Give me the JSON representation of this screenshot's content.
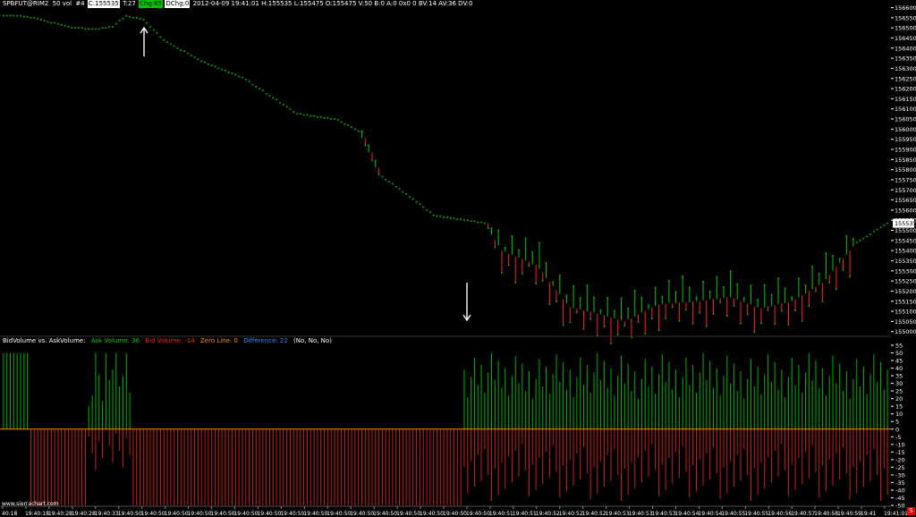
{
  "header": {
    "symbol": "SPBFUT@RIM2",
    "bar_spec": "50 vol",
    "bar_number": "#4",
    "close_label": "C:155535",
    "trades_label": "T:27",
    "change_label": "Chg:65",
    "dchg_label": "DChg:0",
    "info": "2012-04-09 19:41:01 H:155535 L:155475 O:155475 V:50 B:0 A:0 0x0 0 BV:14 AV:36 DV:0"
  },
  "indicator": {
    "title": "BidVolume vs. AskVolume:",
    "ask": "Ask Volume: 36",
    "bid": "Bid Volume: -14",
    "zero": "Zero Line: 0",
    "diff": "Difference: 22",
    "flags": "(No, No, No)"
  },
  "watermark": "www.sierrachart.com",
  "scale_tag": "S",
  "colors": {
    "up": "#00c800",
    "down": "#ff2020",
    "ask": "#00b400",
    "bid": "#c81e1e",
    "zero": "#ff8c00",
    "diff": "#1e90ff",
    "bg": "#000000",
    "axis_text": "#ffffff",
    "price_tag_bg": "#ffffff"
  },
  "price_axis": {
    "ticks": [
      "156600",
      "156550",
      "156500",
      "156450",
      "156400",
      "156350",
      "156300",
      "156250",
      "156200",
      "156150",
      "156100",
      "156050",
      "156000",
      "155950",
      "155900",
      "155850",
      "155800",
      "155750",
      "155700",
      "155650",
      "155600",
      "155550",
      "155500",
      "155450",
      "155400",
      "155350",
      "155300",
      "155250",
      "155200",
      "155150",
      "155100",
      "155050",
      "155000"
    ],
    "current_label": "155535"
  },
  "volume_axis": {
    "ticks": [
      "55",
      "50",
      "45",
      "40",
      "35",
      "30",
      "25",
      "20",
      "15",
      "10",
      "5",
      "0",
      "-5",
      "-10",
      "-15",
      "-20",
      "-25",
      "-30",
      "-35",
      "-40",
      "-45",
      "-50"
    ]
  },
  "time_axis": {
    "labels": [
      "40:18",
      "19:40:18",
      "19:40:28",
      "19:40:28",
      "19:40:33",
      "19:40:50",
      "19:40:50",
      "19:40:50",
      "19:40:50",
      "19:40:50",
      "19:40:50",
      "19:40:50",
      "19:40:50",
      "19:40:50",
      "19:40:50",
      "19:40:50",
      "19:40:50",
      "19:40:50",
      "19:40:50",
      "19:40:50",
      "19:40:50",
      "19:40:51",
      "19:40:51",
      "19:40:52",
      "19:40:52",
      "19:40:52",
      "19:40:53",
      "19:40:53",
      "19:40:53",
      "19:40:54",
      "19:40:54",
      "19:40:55",
      "19:40:55",
      "19:40:56",
      "19:40:57",
      "19:40:58",
      "19:40:59",
      "19:41",
      "19:41:01"
    ]
  },
  "annotations": [
    {
      "type": "arrow-up",
      "label": ""
    },
    {
      "type": "arrow-down",
      "label": ""
    }
  ],
  "chart_data": [
    {
      "type": "line",
      "title": "SPBFUT@RIM2 50 vol",
      "description_series": "price bars (range per bar shown as vertical segments)",
      "ylim": [
        154990,
        156620
      ],
      "grid": false,
      "anchors": [
        {
          "bar": 0,
          "price": 156560
        },
        {
          "bar": 4,
          "price": 156560
        },
        {
          "bar": 10,
          "price": 156545
        },
        {
          "bar": 20,
          "price": 156500
        },
        {
          "bar": 27,
          "price": 156495
        },
        {
          "bar": 32,
          "price": 156505
        },
        {
          "bar": 36,
          "price": 156560
        },
        {
          "bar": 41,
          "price": 156540
        },
        {
          "bar": 47,
          "price": 156440
        },
        {
          "bar": 58,
          "price": 156335
        },
        {
          "bar": 70,
          "price": 156255
        },
        {
          "bar": 78,
          "price": 156165
        },
        {
          "bar": 86,
          "price": 156075
        },
        {
          "bar": 98,
          "price": 156045
        },
        {
          "bar": 104,
          "price": 155990
        },
        {
          "bar": 110,
          "price": 155775
        },
        {
          "bar": 118,
          "price": 155680
        },
        {
          "bar": 126,
          "price": 155575
        },
        {
          "bar": 141,
          "price": 155535
        },
        {
          "bar": 146,
          "price": 155400
        },
        {
          "bar": 156,
          "price": 155330
        },
        {
          "bar": 166,
          "price": 155120
        },
        {
          "bar": 174,
          "price": 155090
        },
        {
          "bar": 182,
          "price": 155050
        },
        {
          "bar": 192,
          "price": 155135
        },
        {
          "bar": 203,
          "price": 155150
        },
        {
          "bar": 213,
          "price": 155170
        },
        {
          "bar": 222,
          "price": 155115
        },
        {
          "bar": 231,
          "price": 155150
        },
        {
          "bar": 240,
          "price": 155240
        },
        {
          "bar": 250,
          "price": 155440
        },
        {
          "bar": 259,
          "price": 155535
        }
      ],
      "bars": 260
    },
    {
      "type": "bar",
      "title": "BidVolume vs. AskVolume",
      "ylim": [
        -50,
        55
      ],
      "segments": [
        {
          "from": 0,
          "to": 7,
          "ask": 50,
          "bid": 0
        },
        {
          "from": 8,
          "to": 24,
          "ask": 0,
          "bid": -50
        },
        {
          "from": 25,
          "to": 37,
          "ask": 40,
          "bid": -20
        },
        {
          "from": 38,
          "to": 134,
          "ask": 0,
          "bid": -50
        },
        {
          "from": 135,
          "to": 259,
          "ask": 38,
          "bid": -30
        }
      ],
      "series": [
        {
          "name": "Ask Volume",
          "color": "#00b400"
        },
        {
          "name": "Bid Volume",
          "color": "#c81e1e"
        }
      ]
    }
  ]
}
